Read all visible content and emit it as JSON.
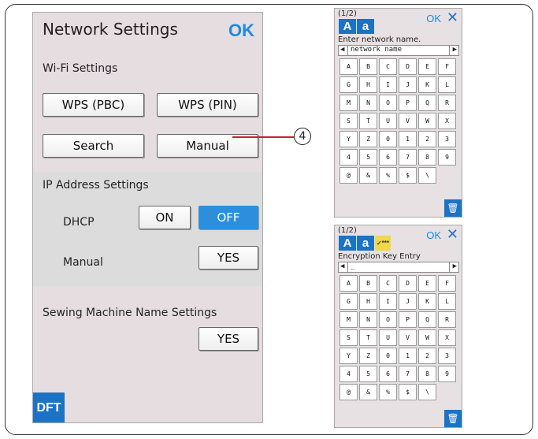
{
  "main": {
    "title": "Network Settings",
    "ok_label": "OK",
    "wifi": {
      "heading": "Wi-Fi Settings",
      "wps_pbc": "WPS (PBC)",
      "wps_pin": "WPS (PIN)",
      "search": "Search",
      "manual": "Manual"
    },
    "ip": {
      "heading": "IP Address Settings",
      "dhcp_label": "DHCP",
      "on": "ON",
      "off": "OFF",
      "dhcp_selected": "OFF",
      "manual_label": "Manual",
      "yes": "YES"
    },
    "name": {
      "heading": "Sewing Machine Name Settings",
      "yes": "YES"
    },
    "dft_label": "DFT"
  },
  "callout": "4",
  "keyboard1": {
    "page": "(1/2)",
    "ok": "OK",
    "close": "✕",
    "upper": "A",
    "lower": "a",
    "prompt": "Enter network name.",
    "value": "network name",
    "keys": [
      "A",
      "B",
      "C",
      "D",
      "E",
      "F",
      "G",
      "H",
      "I",
      "J",
      "K",
      "L",
      "M",
      "N",
      "O",
      "P",
      "Q",
      "R",
      "S",
      "T",
      "U",
      "V",
      "W",
      "X",
      "Y",
      "Z",
      "0",
      "1",
      "2",
      "3",
      "4",
      "5",
      "6",
      "7",
      "8",
      "9",
      "@",
      "&",
      "%",
      "$",
      "\\"
    ]
  },
  "keyboard2": {
    "page": "(1/2)",
    "ok": "OK",
    "close": "✕",
    "upper": "A",
    "lower": "a",
    "mask": "✓***",
    "prompt": "Encryption Key Entry",
    "value": "_",
    "keys": [
      "A",
      "B",
      "C",
      "D",
      "E",
      "F",
      "G",
      "H",
      "I",
      "J",
      "K",
      "L",
      "M",
      "N",
      "O",
      "P",
      "Q",
      "R",
      "S",
      "T",
      "U",
      "V",
      "W",
      "X",
      "Y",
      "Z",
      "0",
      "1",
      "2",
      "3",
      "4",
      "5",
      "6",
      "7",
      "8",
      "9",
      "@",
      "&",
      "%",
      "$",
      "\\"
    ]
  },
  "colors": {
    "accent": "#1c73c4",
    "ok_text": "#1c8be0",
    "selected": "#2b8fdd",
    "callout_line": "#c8202c"
  }
}
